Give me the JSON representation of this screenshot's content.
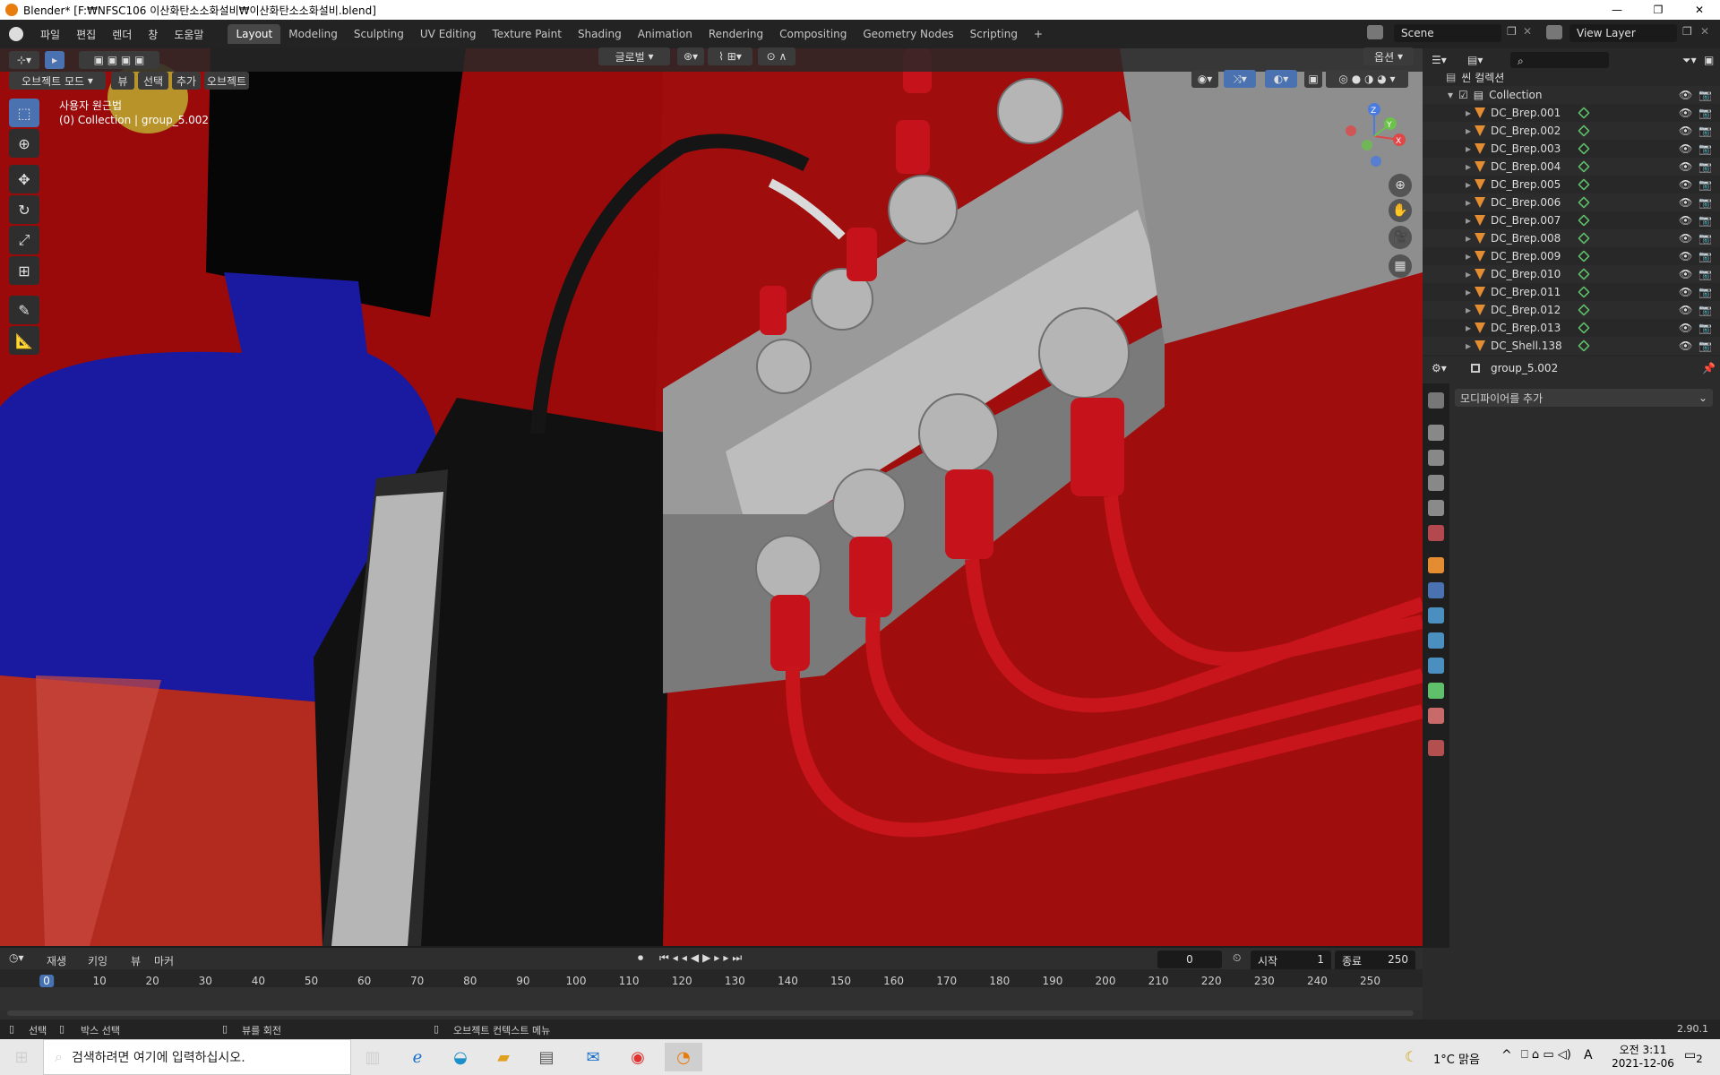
{
  "window": {
    "title": "Blender* [F:₩NFSC106 이산화탄소소화설비₩이산화탄소소화설비.blend]",
    "minimize": "—",
    "maximize": "❐",
    "close": "✕"
  },
  "menu": [
    "파일",
    "편집",
    "렌더",
    "창",
    "도움말"
  ],
  "workspaces": [
    "Layout",
    "Modeling",
    "Sculpting",
    "UV Editing",
    "Texture Paint",
    "Shading",
    "Animation",
    "Rendering",
    "Compositing",
    "Geometry Nodes",
    "Scripting"
  ],
  "add_workspace": "+",
  "scene_field": "Scene",
  "view_layer_field": "View Layer",
  "viewport_header": {
    "mode": "오브젝트 모드",
    "menus": [
      "뷰",
      "선택",
      "추가",
      "오브젝트"
    ],
    "orientation": "글로벌",
    "options": "옵션"
  },
  "viewport_overlay": {
    "view_name": "사용자 원근법",
    "collection_info": "(0) Collection | group_5.002"
  },
  "gizmo": {
    "x": "X",
    "y": "Y",
    "z": "Z"
  },
  "outliner": {
    "root": "씬 컬렉션",
    "collection": "Collection",
    "items": [
      "DC_Brep.001",
      "DC_Brep.002",
      "DC_Brep.003",
      "DC_Brep.004",
      "DC_Brep.005",
      "DC_Brep.006",
      "DC_Brep.007",
      "DC_Brep.008",
      "DC_Brep.009",
      "DC_Brep.010",
      "DC_Brep.011",
      "DC_Brep.012",
      "DC_Brep.013",
      "DC_Shell.138"
    ]
  },
  "properties": {
    "object_name": "group_5.002",
    "add_modifier": "모디파이어를 추가"
  },
  "timeline": {
    "menus": [
      "재생",
      "키잉",
      "뷰",
      "마커"
    ],
    "current_frame": "0",
    "start_label": "시작",
    "start_value": "1",
    "end_label": "종료",
    "end_value": "250",
    "ticks": [
      "0",
      "10",
      "20",
      "30",
      "40",
      "50",
      "60",
      "70",
      "80",
      "90",
      "100",
      "110",
      "120",
      "130",
      "140",
      "150",
      "160",
      "170",
      "180",
      "190",
      "200",
      "210",
      "220",
      "230",
      "240",
      "250"
    ]
  },
  "statusbar": {
    "select": "선택",
    "box_select": "박스 선택",
    "rotate_view": "뷰를 회전",
    "context_menu": "오브젝트 컨텍스트 메뉴",
    "version": "2.90.1"
  },
  "taskbar": {
    "search_placeholder": "검색하려면 여기에 입력하십시오.",
    "weather": "1°C 맑음",
    "time": "오전 3:11",
    "date": "2021-12-06",
    "notifications": "2",
    "ime": "A"
  },
  "colors": {
    "accent": "#4a72b0",
    "active_frame": "#4772b3",
    "background_red": "#9c0a0a"
  }
}
